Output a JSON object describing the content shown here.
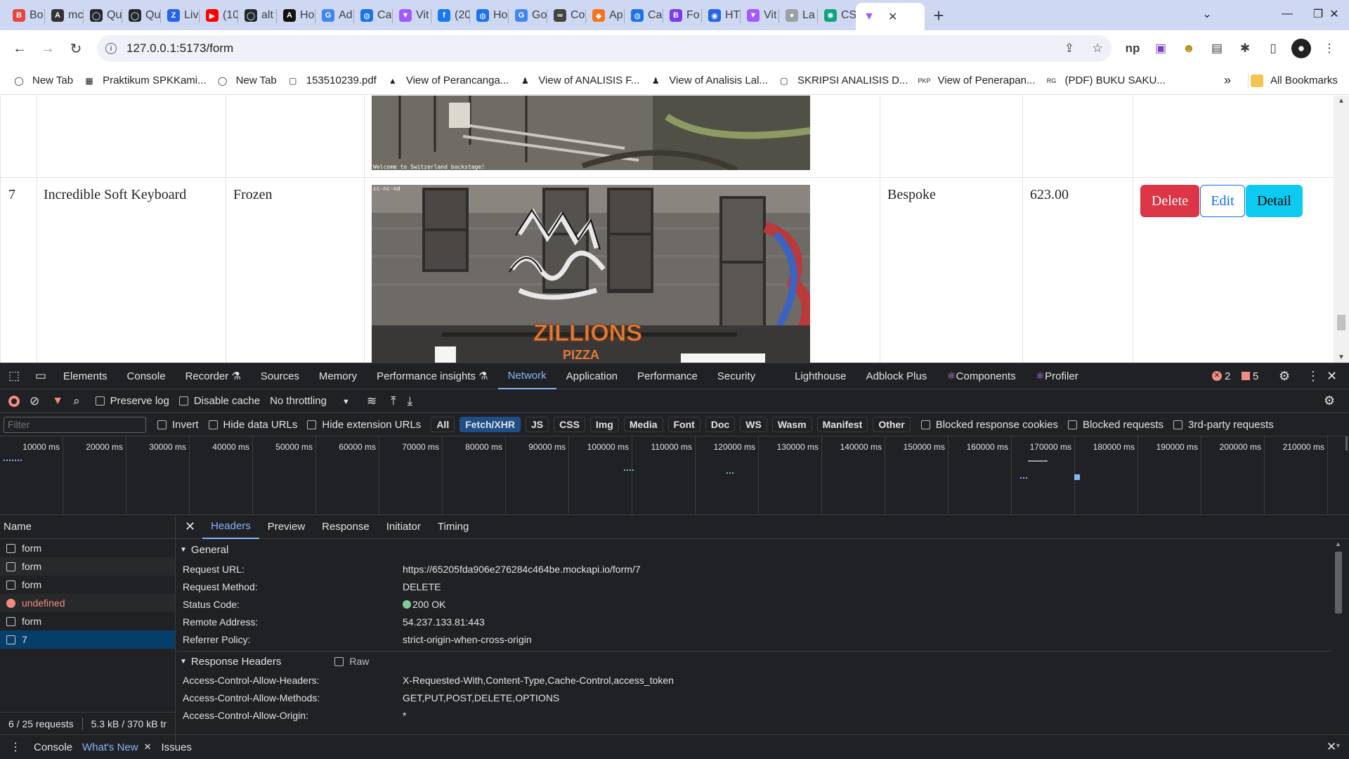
{
  "browser": {
    "tabs": [
      {
        "title": "Bo",
        "color": "#e8453c",
        "glyph": "B"
      },
      {
        "title": "mc",
        "color": "#333333",
        "glyph": "A"
      },
      {
        "title": "Qu",
        "color": "#24292f",
        "glyph": "◯"
      },
      {
        "title": "Qu",
        "color": "#24292f",
        "glyph": "◯"
      },
      {
        "title": "Liv",
        "color": "#2563eb",
        "glyph": "Z"
      },
      {
        "title": "(10",
        "color": "#ff0000",
        "glyph": "▶"
      },
      {
        "title": "alt",
        "color": "#24292f",
        "glyph": "◯"
      },
      {
        "title": "Ho",
        "color": "#111111",
        "glyph": "A"
      },
      {
        "title": "Ad",
        "color": "#4285f4",
        "glyph": "G"
      },
      {
        "title": "Ca",
        "color": "#1a73e8",
        "glyph": "◍"
      },
      {
        "title": "Vit",
        "color": "#a259ff",
        "glyph": "▼"
      },
      {
        "title": "(20",
        "color": "#1877f2",
        "glyph": "f"
      },
      {
        "title": "Ho",
        "color": "#1a73e8",
        "glyph": "◍"
      },
      {
        "title": "Go",
        "color": "#4285f4",
        "glyph": "G"
      },
      {
        "title": "Co",
        "color": "#444444",
        "glyph": "∞"
      },
      {
        "title": "Ap",
        "color": "#f97316",
        "glyph": "◆"
      },
      {
        "title": "Ca",
        "color": "#1a73e8",
        "glyph": "◍"
      },
      {
        "title": "Fo",
        "color": "#7c3aed",
        "glyph": "B"
      },
      {
        "title": "HT",
        "color": "#2563eb",
        "glyph": "◉"
      },
      {
        "title": "Vit",
        "color": "#a259ff",
        "glyph": "▼"
      },
      {
        "title": "La",
        "color": "#9aa0a6",
        "glyph": "●"
      },
      {
        "title": "CS",
        "color": "#10a37f",
        "glyph": "✺"
      }
    ],
    "active_tab": {
      "title": "",
      "color": "#a259ff",
      "glyph": "▼",
      "close": "✕"
    },
    "new_tab_glyph": "+",
    "window_controls": {
      "list": "⌄",
      "minimize": "—",
      "restore": "❐",
      "close": "✕"
    },
    "url": "127.0.0.1:5173/form",
    "info_glyph": "i",
    "bookmarks": [
      {
        "label": "New Tab",
        "icon": "github-icon",
        "glyph": "◯"
      },
      {
        "label": "Praktikum SPKKami...",
        "icon": "folder-image-icon",
        "glyph": "▦"
      },
      {
        "label": "New Tab",
        "icon": "github-icon",
        "glyph": "◯"
      },
      {
        "label": "153510239.pdf",
        "icon": "document-icon",
        "glyph": "▢"
      },
      {
        "label": "View of Perancanga...",
        "icon": "journal-icon",
        "glyph": "▲"
      },
      {
        "label": "View of ANALISIS F...",
        "icon": "journal-icon",
        "glyph": "♟"
      },
      {
        "label": "View of Analisis Lal...",
        "icon": "journal-icon",
        "glyph": "♟"
      },
      {
        "label": "SKRIPSI ANALISIS D...",
        "icon": "document-icon",
        "glyph": "▢"
      },
      {
        "label": "View of Penerapan...",
        "icon": "pkp-icon",
        "glyph": "PKP"
      },
      {
        "label": "(PDF) BUKU SAKU...",
        "icon": "researchgate-icon",
        "glyph": "RG"
      }
    ],
    "bookmarks_overflow": "»",
    "all_bookmarks": "All Bookmarks"
  },
  "page": {
    "row": {
      "id": "7",
      "name": "Incredible Soft Keyboard",
      "category": "Frozen",
      "material": "Bespoke",
      "price": "623.00"
    },
    "top_image_caption": "Welcome to Switzerland backstage!",
    "image_license": "cc-nc-nd",
    "image_sign": "ZILLIONS",
    "image_sign2": "PIZZA",
    "buttons": {
      "delete": "Delete",
      "edit": "Edit",
      "detail": "Detail"
    },
    "colors": {
      "delete": "#dc3545",
      "edit": "#0d6efd",
      "detail": "#0dcaf0"
    }
  },
  "devtools": {
    "tabs": [
      "Elements",
      "Console",
      "Recorder ⚗",
      "Sources",
      "Memory",
      "Performance insights ⚗",
      "Network",
      "Application",
      "Performance",
      "Security",
      "Lighthouse",
      "Adblock Plus",
      "Components",
      "Profiler"
    ],
    "active_tab": "Network",
    "errors": "2",
    "warnings": "5",
    "netbar": {
      "preserve_log": "Preserve log",
      "disable_cache": "Disable cache",
      "throttling": "No throttling"
    },
    "filter_placeholder": "Filter",
    "filter_checks": [
      "Invert",
      "Hide data URLs",
      "Hide extension URLs"
    ],
    "type_filters": [
      "All",
      "Fetch/XHR",
      "JS",
      "CSS",
      "Img",
      "Media",
      "Font",
      "Doc",
      "WS",
      "Wasm",
      "Manifest",
      "Other"
    ],
    "selected_type": "Fetch/XHR",
    "extra_checks": [
      "Blocked response cookies",
      "Blocked requests",
      "3rd-party requests"
    ],
    "timeline_ticks": [
      "10000 ms",
      "20000 ms",
      "30000 ms",
      "40000 ms",
      "50000 ms",
      "60000 ms",
      "70000 ms",
      "80000 ms",
      "90000 ms",
      "100000 ms",
      "110000 ms",
      "120000 ms",
      "130000 ms",
      "140000 ms",
      "150000 ms",
      "160000 ms",
      "170000 ms",
      "180000 ms",
      "190000 ms",
      "200000 ms",
      "210000 ms"
    ],
    "name_header": "Name",
    "requests": [
      {
        "name": "form",
        "status": "ok"
      },
      {
        "name": "form",
        "status": "ok"
      },
      {
        "name": "form",
        "status": "ok"
      },
      {
        "name": "undefined",
        "status": "error"
      },
      {
        "name": "form",
        "status": "ok"
      },
      {
        "name": "7",
        "status": "selected"
      }
    ],
    "summary": "6 / 25 requests",
    "transferred": "5.3 kB / 370 kB tr",
    "detail_tabs": [
      "Headers",
      "Preview",
      "Response",
      "Initiator",
      "Timing"
    ],
    "active_detail_tab": "Headers",
    "general_title": "General",
    "general": [
      {
        "k": "Request URL:",
        "v": "https://65205fda906e276284c464be.mockapi.io/form/7"
      },
      {
        "k": "Request Method:",
        "v": "DELETE"
      },
      {
        "k": "Status Code:",
        "v": "200 OK"
      },
      {
        "k": "Remote Address:",
        "v": "54.237.133.81:443"
      },
      {
        "k": "Referrer Policy:",
        "v": "strict-origin-when-cross-origin"
      }
    ],
    "response_title": "Response Headers",
    "raw_label": "Raw",
    "response_headers": [
      {
        "k": "Access-Control-Allow-Headers:",
        "v": "X-Requested-With,Content-Type,Cache-Control,access_token"
      },
      {
        "k": "Access-Control-Allow-Methods:",
        "v": "GET,PUT,POST,DELETE,OPTIONS"
      },
      {
        "k": "Access-Control-Allow-Origin:",
        "v": "*"
      }
    ],
    "drawer_tabs": [
      "Console",
      "What's New",
      "Issues"
    ],
    "active_drawer_tab": "What's New"
  }
}
